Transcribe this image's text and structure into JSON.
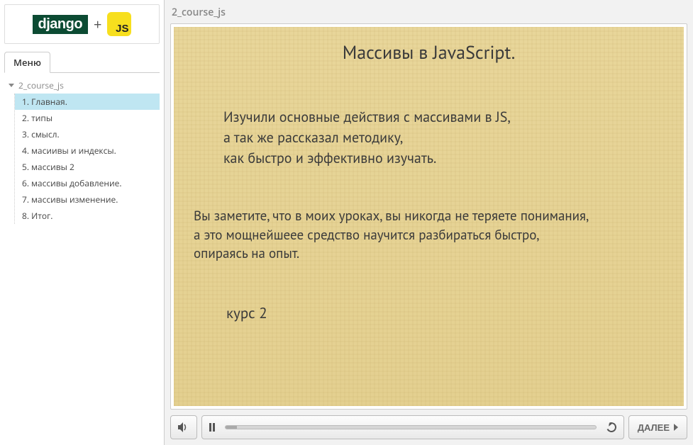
{
  "logo": {
    "django": "django",
    "plus": "+",
    "js": "JS"
  },
  "sidebar": {
    "menu_tab": "Меню",
    "root": "2_course_js",
    "items": [
      "1. Главная.",
      "2. типы",
      "3. смысл.",
      "4. масиивы и индексы.",
      "5. массивы 2",
      "6. массивы добавление.",
      "7. массивы изменение.",
      "8. Итог."
    ],
    "selected_index": 0
  },
  "breadcrumb": "2_course_js",
  "slide": {
    "title": "Массивы в JavaScript.",
    "block1_line1": "Изучили основные действия с массивами в JS,",
    "block1_line2": "а так же рассказал методику,",
    "block1_line3": "как быстро и эффективно изучать.",
    "block2_line1": "Вы заметите, что в моих уроках, вы никогда не теряете понимания,",
    "block2_line2": "а это мощнейшеее средство научится разбираться быстро,",
    "block2_line3": "опираясь на опыт.",
    "footer": "курс 2"
  },
  "controls": {
    "next": "ДАЛЕЕ"
  }
}
